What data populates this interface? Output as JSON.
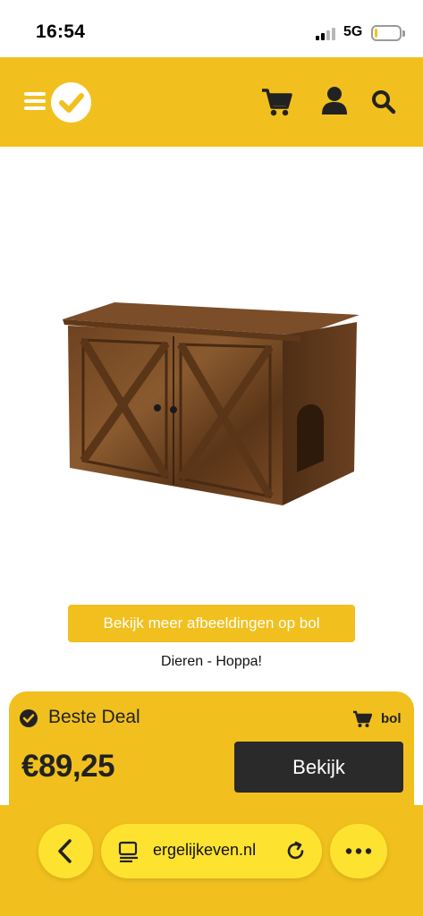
{
  "status_bar": {
    "time": "16:54",
    "network": "5G",
    "icons": [
      "signal-icon",
      "battery-icon"
    ]
  },
  "header": {
    "brand_color": "#f1c01e",
    "icons": [
      "menu-icon",
      "logo-check-icon",
      "cart-icon",
      "user-icon",
      "search-icon"
    ]
  },
  "product": {
    "image": "wooden-cabinet-product-image",
    "more_images_label": "Bekijk meer afbeeldingen op bol",
    "category": "Dieren - Hoppa!"
  },
  "deal": {
    "title": "Beste Deal",
    "shop": "bol",
    "price": "€89,25",
    "button_label": "Bekijk",
    "icons": [
      "check-circle-icon",
      "cart-icon"
    ]
  },
  "browser": {
    "url": "ergelijkeven.nl",
    "icons": [
      "back-arrow-icon",
      "reader-icon",
      "reload-icon",
      "more-icon"
    ]
  },
  "colors": {
    "accent": "#f1c01e",
    "pill": "#fde32f",
    "dark_button": "#2a2a2a"
  }
}
